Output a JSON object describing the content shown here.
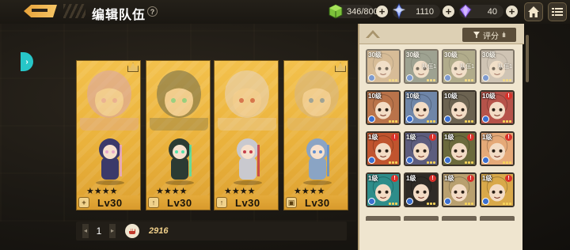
{
  "header": {
    "title": "编辑队伍",
    "help_glyph": "?",
    "resources": {
      "stamina": "346/800",
      "crystal": "1110",
      "gem": "40"
    },
    "plus_glyph": "+"
  },
  "team": {
    "slots": [
      {
        "level": "Lv30",
        "stars": "★★★★",
        "role_glyph": "+",
        "portrait_color": "#d9a6b0",
        "chibi_color": "#3b3a6a",
        "accent": "#e7a8c8"
      },
      {
        "level": "Lv30",
        "stars": "★★★★",
        "role_glyph": "↑",
        "portrait_color": "#6d6a4c",
        "chibi_color": "#2c3b33",
        "accent": "#54e0a7"
      },
      {
        "level": "Lv30",
        "stars": "★★★★",
        "role_glyph": "↑",
        "portrait_color": "#e7d5c3",
        "chibi_color": "#c9c9cf",
        "accent": "#c53d4a"
      },
      {
        "level": "Lv30",
        "stars": "★★★★",
        "role_glyph": "▣",
        "portrait_color": "#d5b78a",
        "chibi_color": "#8aa4c4",
        "accent": "#5f8fd0"
      }
    ]
  },
  "footer": {
    "page": "1",
    "prev_glyph": "◂",
    "next_glyph": "▸",
    "power": "2916"
  },
  "roster": {
    "sort_label": "评分",
    "sort_bars": "ılı",
    "heroes": [
      {
        "level": "30级",
        "tag": "",
        "alert": false,
        "color": "#c9a476",
        "dim": true
      },
      {
        "level": "30级",
        "tag": "队伍1",
        "alert": false,
        "color": "#6d7a6c",
        "dim": true
      },
      {
        "level": "30级",
        "tag": "队伍1",
        "alert": false,
        "color": "#8c8a62",
        "dim": true
      },
      {
        "level": "30级",
        "tag": "队伍1",
        "alert": false,
        "color": "#bdb0a4",
        "dim": true
      },
      {
        "level": "10级",
        "tag": "",
        "alert": false,
        "color": "#b9734a",
        "dim": false
      },
      {
        "level": "10级",
        "tag": "",
        "alert": false,
        "color": "#6f86a8",
        "dim": false
      },
      {
        "level": "10级",
        "tag": "",
        "alert": false,
        "color": "#6c6351",
        "dim": false
      },
      {
        "level": "10级",
        "tag": "",
        "alert": true,
        "color": "#b6534a",
        "dim": false
      },
      {
        "level": "1级",
        "tag": "",
        "alert": true,
        "color": "#c0542e",
        "dim": false
      },
      {
        "level": "1级",
        "tag": "",
        "alert": true,
        "color": "#5d5d7e",
        "dim": false
      },
      {
        "level": "1级",
        "tag": "",
        "alert": true,
        "color": "#6b6a3c",
        "dim": false
      },
      {
        "level": "1级",
        "tag": "",
        "alert": true,
        "color": "#e5a978",
        "dim": false
      },
      {
        "level": "1级",
        "tag": "",
        "alert": true,
        "color": "#2e8d8a",
        "dim": false
      },
      {
        "level": "1级",
        "tag": "",
        "alert": true,
        "color": "#2f2b26",
        "dim": false
      },
      {
        "level": "1级",
        "tag": "",
        "alert": true,
        "color": "#b9a06f",
        "dim": false
      },
      {
        "level": "1级",
        "tag": "",
        "alert": true,
        "color": "#d9a94a",
        "dim": false
      }
    ]
  }
}
